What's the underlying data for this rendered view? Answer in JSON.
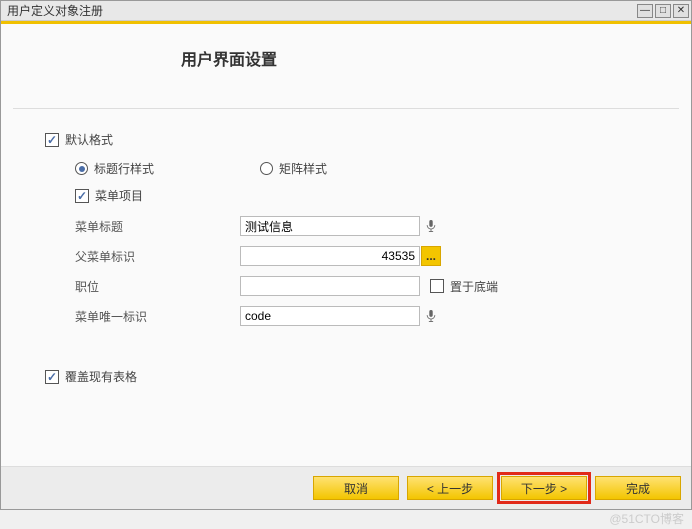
{
  "window": {
    "title": "用户定义对象注册"
  },
  "section": {
    "title": "用户界面设置"
  },
  "options": {
    "default_format_label": "默认格式",
    "row_style_label": "标题行样式",
    "matrix_style_label": "矩阵样式",
    "menu_item_label": "菜单项目",
    "overwrite_label": "覆盖现有表格"
  },
  "fields": {
    "menu_title": {
      "label": "菜单标题",
      "value": "测试信息"
    },
    "parent_menu_id": {
      "label": "父菜单标识",
      "value": "43535"
    },
    "position": {
      "label": "职位",
      "value": ""
    },
    "place_bottom_label": "置于底端",
    "menu_unique_id": {
      "label": "菜单唯一标识",
      "value": "code"
    }
  },
  "buttons": {
    "cancel": "取消",
    "prev": "< 上一步",
    "next": "下一步 >",
    "finish": "完成",
    "browse": "..."
  },
  "watermark": "@51CTO博客"
}
